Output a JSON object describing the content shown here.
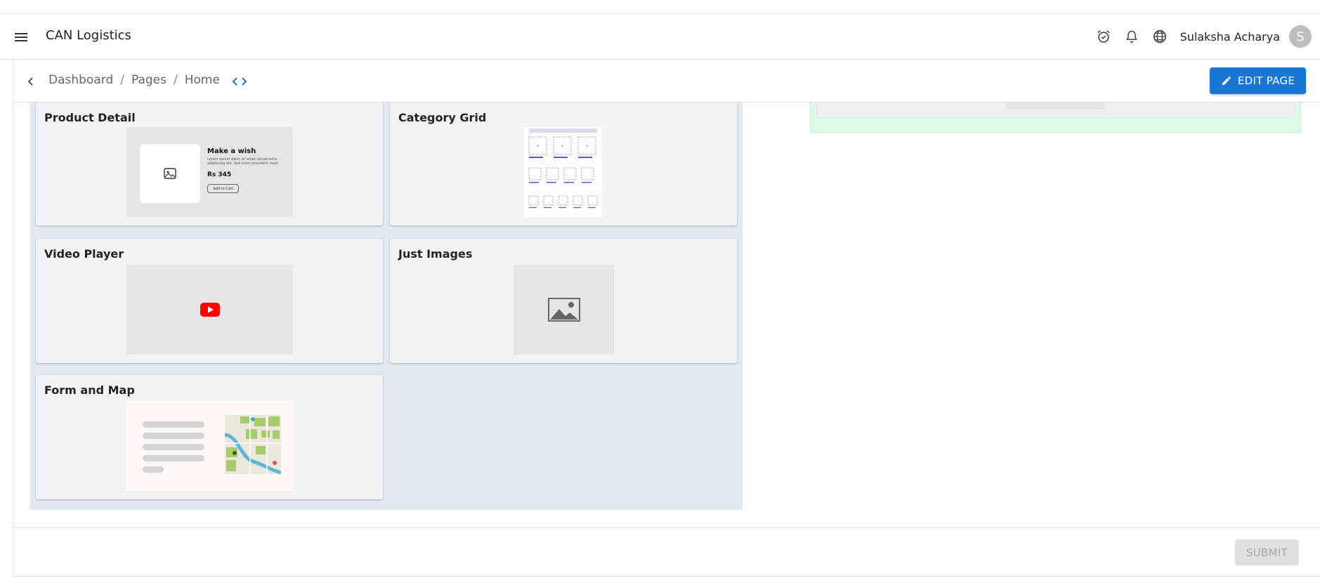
{
  "header": {
    "app_title": "CAN Logistics",
    "user_name": "Sulaksha Acharya",
    "avatar_initial": "S"
  },
  "breadcrumb": {
    "items": [
      "Dashboard",
      "Pages",
      "Home"
    ],
    "separator": "/"
  },
  "actions": {
    "edit_page": "EDIT PAGE",
    "submit": "SUBMIT"
  },
  "templates": [
    {
      "title": "Product Detail"
    },
    {
      "title": "Category Grid"
    },
    {
      "title": "Video Player"
    },
    {
      "title": "Just Images"
    },
    {
      "title": "Form and Map"
    }
  ],
  "product_preview": {
    "heading": "Make a wish",
    "body": "Lorem ipsum dolor sit amet consectetur adipiscing elit. Sed enim provident modi est.",
    "price": "Rs 345",
    "button": "Add to Cart"
  },
  "colors": {
    "primary": "#1976d2",
    "panel_bg": "#e2e8f0",
    "card_bg": "#f2f3f5",
    "green_panel": "#ddfbe7",
    "youtube_red": "#ff0000"
  }
}
